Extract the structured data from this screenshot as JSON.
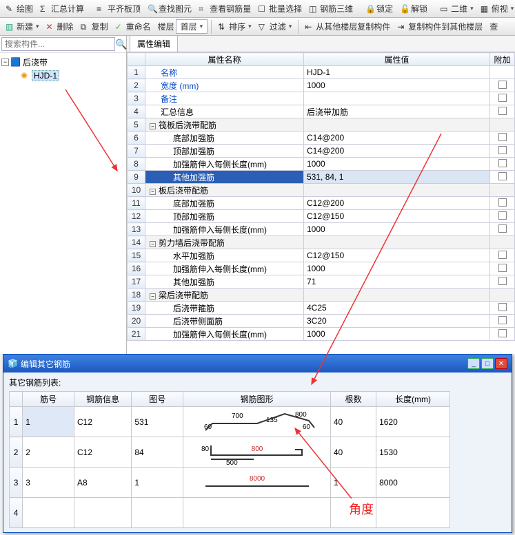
{
  "toolbar1": {
    "items": [
      "绘图",
      "汇总计算",
      "平齐板顶",
      "查找图元",
      "查看钢筋量",
      "批量选择",
      "钢筋三维",
      "锁定",
      "解锁",
      "二维",
      "俯视"
    ]
  },
  "toolbar2": {
    "new": "新建",
    "del": "删除",
    "copy": "复制",
    "rename": "重命名",
    "floor_lbl": "楼层",
    "floor": "首层",
    "sort": "排序",
    "filter": "过滤",
    "copyfrom": "从其他楼层复制构件",
    "copyto": "复制构件到其他楼层",
    "more": "查"
  },
  "search": {
    "placeholder": "搜索构件..."
  },
  "tree": {
    "root": "后浇带",
    "child": "HJD-1"
  },
  "tab": "属性编辑",
  "headers": {
    "name": "属性名称",
    "value": "属性值",
    "add": "附加"
  },
  "rows": [
    {
      "n": 1,
      "name": "名称",
      "val": "HJD-1",
      "link": true,
      "cb": false
    },
    {
      "n": 2,
      "name": "宽度 (mm)",
      "val": "1000",
      "link": true,
      "cb": true
    },
    {
      "n": 3,
      "name": "备注",
      "val": "",
      "link": true,
      "cb": true
    },
    {
      "n": 4,
      "name": "汇总信息",
      "val": "后浇带加筋",
      "cb": true
    },
    {
      "n": 5,
      "grp": true,
      "name": "筏板后浇带配筋"
    },
    {
      "n": 6,
      "indent": 2,
      "name": "底部加强筋",
      "val": "C14@200",
      "cb": true
    },
    {
      "n": 7,
      "indent": 2,
      "name": "顶部加强筋",
      "val": "C14@200",
      "cb": true
    },
    {
      "n": 8,
      "indent": 2,
      "name": "加强筋伸入每侧长度(mm)",
      "val": "1000",
      "cb": true
    },
    {
      "n": 9,
      "indent": 2,
      "name": "其他加强筋",
      "val": "531, 84, 1",
      "link": true,
      "sel": true,
      "cb": true
    },
    {
      "n": 10,
      "grp": true,
      "name": "板后浇带配筋"
    },
    {
      "n": 11,
      "indent": 2,
      "name": "底部加强筋",
      "val": "C12@200",
      "cb": true
    },
    {
      "n": 12,
      "indent": 2,
      "name": "顶部加强筋",
      "val": "C12@150",
      "cb": true
    },
    {
      "n": 13,
      "indent": 2,
      "name": "加强筋伸入每侧长度(mm)",
      "val": "1000",
      "cb": true
    },
    {
      "n": 14,
      "grp": true,
      "name": "剪力墙后浇带配筋"
    },
    {
      "n": 15,
      "indent": 2,
      "name": "水平加强筋",
      "val": "C12@150",
      "cb": true
    },
    {
      "n": 16,
      "indent": 2,
      "name": "加强筋伸入每侧长度(mm)",
      "val": "1000",
      "cb": true
    },
    {
      "n": 17,
      "indent": 2,
      "name": "其他加强筋",
      "val": "71",
      "cb": true
    },
    {
      "n": 18,
      "grp": true,
      "name": "梁后浇带配筋"
    },
    {
      "n": 19,
      "indent": 2,
      "name": "后浇带箍筋",
      "val": "4C25",
      "cb": true
    },
    {
      "n": 20,
      "indent": 2,
      "name": "后浇带侧面筋",
      "val": "3C20",
      "cb": true
    },
    {
      "n": 21,
      "indent": 2,
      "name": "加强筋伸入每侧长度(mm)",
      "val": "1000",
      "cb": true
    }
  ],
  "dialog": {
    "title": "编辑其它钢筋",
    "list_label": "其它钢筋列表:",
    "headers": {
      "id": "筋号",
      "info": "钢筋信息",
      "tu": "图号",
      "shape": "钢筋图形",
      "gen": "根数",
      "len": "长度(mm)"
    },
    "rows": [
      {
        "rn": 1,
        "id": "1",
        "info": "C12",
        "tu": "531",
        "shape": {
          "type": "bent",
          "labels": [
            "60",
            "700",
            "135",
            "800",
            "60"
          ]
        },
        "gen": "40",
        "len": "1620"
      },
      {
        "rn": 2,
        "id": "2",
        "info": "C12",
        "tu": "84",
        "shape": {
          "type": "hook",
          "labels": [
            "80",
            "800",
            "500"
          ]
        },
        "gen": "40",
        "len": "1530"
      },
      {
        "rn": 3,
        "id": "3",
        "info": "A8",
        "tu": "1",
        "shape": {
          "type": "straight",
          "labels": [
            "8000"
          ]
        },
        "gen": "1",
        "len": "8000"
      },
      {
        "rn": 4,
        "id": "",
        "info": "",
        "tu": "",
        "shape": null,
        "gen": "",
        "len": ""
      }
    ]
  },
  "annotation": "角度"
}
